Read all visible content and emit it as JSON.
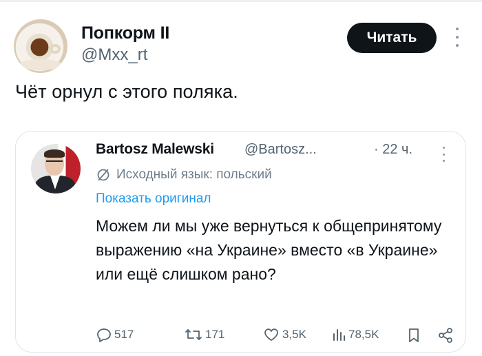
{
  "tweet": {
    "author_name": "Попкорм II",
    "author_handle": "@Mxx_rt",
    "follow_label": "Читать",
    "text": "Чёт орнул с этого поляка."
  },
  "quoted": {
    "author_name": "Bartosz Malewski",
    "author_handle": "@Bartosz...",
    "time": "· 22 ч.",
    "translate_label": "Исходный язык: польский",
    "show_original": "Показать оригинал",
    "text": "Можем ли мы уже вернуться к общепринятому выражению «на Украине» вместо «в Украине» или ещё слишком рано?",
    "actions": {
      "replies": "517",
      "reposts": "171",
      "likes": "3,5K",
      "views": "78,5K"
    }
  },
  "icons": [
    "translate-icon",
    "reply-icon",
    "repost-icon",
    "like-icon",
    "views-icon",
    "bookmark-icon",
    "share-icon",
    "more-icon"
  ],
  "colors": {
    "accent": "#1d9bf0",
    "secondary_text": "#536471",
    "button_bg": "#0f1419"
  }
}
